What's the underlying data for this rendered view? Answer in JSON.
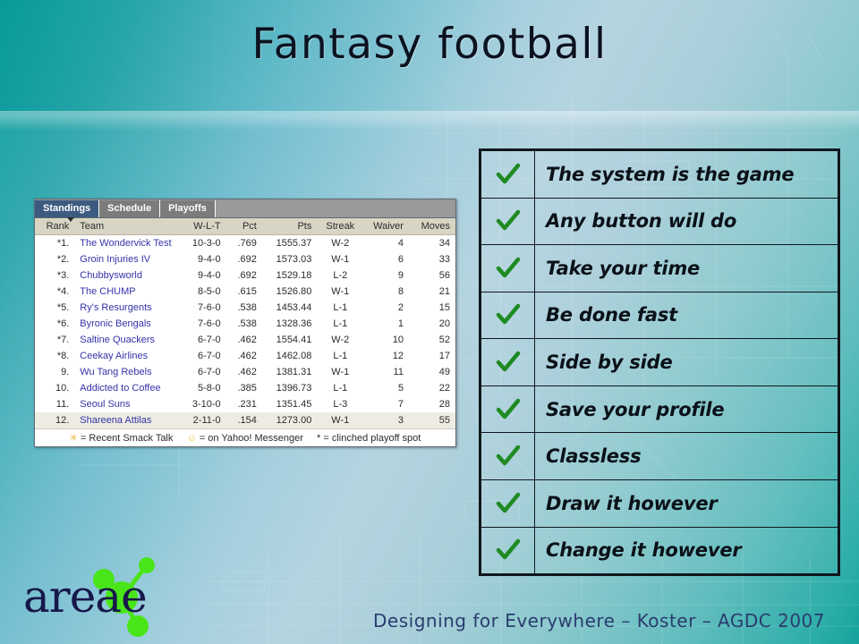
{
  "slide": {
    "title": "Fantasy football",
    "footer_text": "Designing for Everywhere – Koster – AGDC 2007",
    "logo_wordmark": "areae",
    "colors": {
      "bg_teal": "#11a09e",
      "bg_light_blue": "#b5d4e0",
      "title_text": "#0b1220",
      "footer_text": "#2a3d6e",
      "logo_word": "#17174a",
      "logo_nodes": "#49e519",
      "check_green": "#1f8a23",
      "box_border": "#10161c"
    }
  },
  "standings": {
    "tabs": [
      {
        "label": "Standings",
        "active": true
      },
      {
        "label": "Schedule",
        "active": false
      },
      {
        "label": "Playoffs",
        "active": false
      }
    ],
    "columns": [
      "Rank",
      "Team",
      "W-L-T",
      "Pct",
      "Pts",
      "Streak",
      "Waiver",
      "Moves"
    ],
    "rows": [
      {
        "rank": "*1.",
        "team": "The Wondervick Test",
        "wlt": "10-3-0",
        "pct": ".769",
        "pts": "1555.37",
        "streak": "W-2",
        "waiver": "4",
        "moves": "34"
      },
      {
        "rank": "*2.",
        "team": "Groin Injuries IV",
        "wlt": "9-4-0",
        "pct": ".692",
        "pts": "1573.03",
        "streak": "W-1",
        "waiver": "6",
        "moves": "33"
      },
      {
        "rank": "*3.",
        "team": "Chubbysworld",
        "wlt": "9-4-0",
        "pct": ".692",
        "pts": "1529.18",
        "streak": "L-2",
        "waiver": "9",
        "moves": "56"
      },
      {
        "rank": "*4.",
        "team": "The CHUMP",
        "wlt": "8-5-0",
        "pct": ".615",
        "pts": "1526.80",
        "streak": "W-1",
        "waiver": "8",
        "moves": "21"
      },
      {
        "rank": "*5.",
        "team": "Ry's Resurgents",
        "wlt": "7-6-0",
        "pct": ".538",
        "pts": "1453.44",
        "streak": "L-1",
        "waiver": "2",
        "moves": "15"
      },
      {
        "rank": "*6.",
        "team": "Byronic Bengals",
        "wlt": "7-6-0",
        "pct": ".538",
        "pts": "1328.36",
        "streak": "L-1",
        "waiver": "1",
        "moves": "20"
      },
      {
        "rank": "*7.",
        "team": "Saltine Quackers",
        "wlt": "6-7-0",
        "pct": ".462",
        "pts": "1554.41",
        "streak": "W-2",
        "waiver": "10",
        "moves": "52"
      },
      {
        "rank": "*8.",
        "team": "Ceekay Airlines",
        "wlt": "6-7-0",
        "pct": ".462",
        "pts": "1462.08",
        "streak": "L-1",
        "waiver": "12",
        "moves": "17"
      },
      {
        "rank": "9.",
        "team": "Wu Tang Rebels",
        "wlt": "6-7-0",
        "pct": ".462",
        "pts": "1381.31",
        "streak": "W-1",
        "waiver": "11",
        "moves": "49"
      },
      {
        "rank": "10.",
        "team": "Addicted to Coffee",
        "wlt": "5-8-0",
        "pct": ".385",
        "pts": "1396.73",
        "streak": "L-1",
        "waiver": "5",
        "moves": "22"
      },
      {
        "rank": "11.",
        "team": "Seoul Suns",
        "wlt": "3-10-0",
        "pct": ".231",
        "pts": "1351.45",
        "streak": "L-3",
        "waiver": "7",
        "moves": "28"
      },
      {
        "rank": "12.",
        "team": "Shareena Attilas",
        "wlt": "2-11-0",
        "pct": ".154",
        "pts": "1273.00",
        "streak": "W-1",
        "waiver": "3",
        "moves": "55"
      }
    ],
    "legend": {
      "smack_glyph": "✳",
      "smack_text": "= Recent Smack Talk",
      "messenger_glyph": "☺",
      "messenger_text": "= on Yahoo! Messenger",
      "clinched_glyph": "*",
      "clinched_text": "= clinched playoff spot"
    }
  },
  "checklist": {
    "items": [
      {
        "label": "The system is the game",
        "checked": true
      },
      {
        "label": "Any button will do",
        "checked": true
      },
      {
        "label": "Take your time",
        "checked": true
      },
      {
        "label": "Be done fast",
        "checked": true
      },
      {
        "label": "Side by side",
        "checked": true
      },
      {
        "label": "Save your profile",
        "checked": true
      },
      {
        "label": "Classless",
        "checked": true
      },
      {
        "label": "Draw it however",
        "checked": true
      },
      {
        "label": "Change it however",
        "checked": true
      }
    ]
  }
}
